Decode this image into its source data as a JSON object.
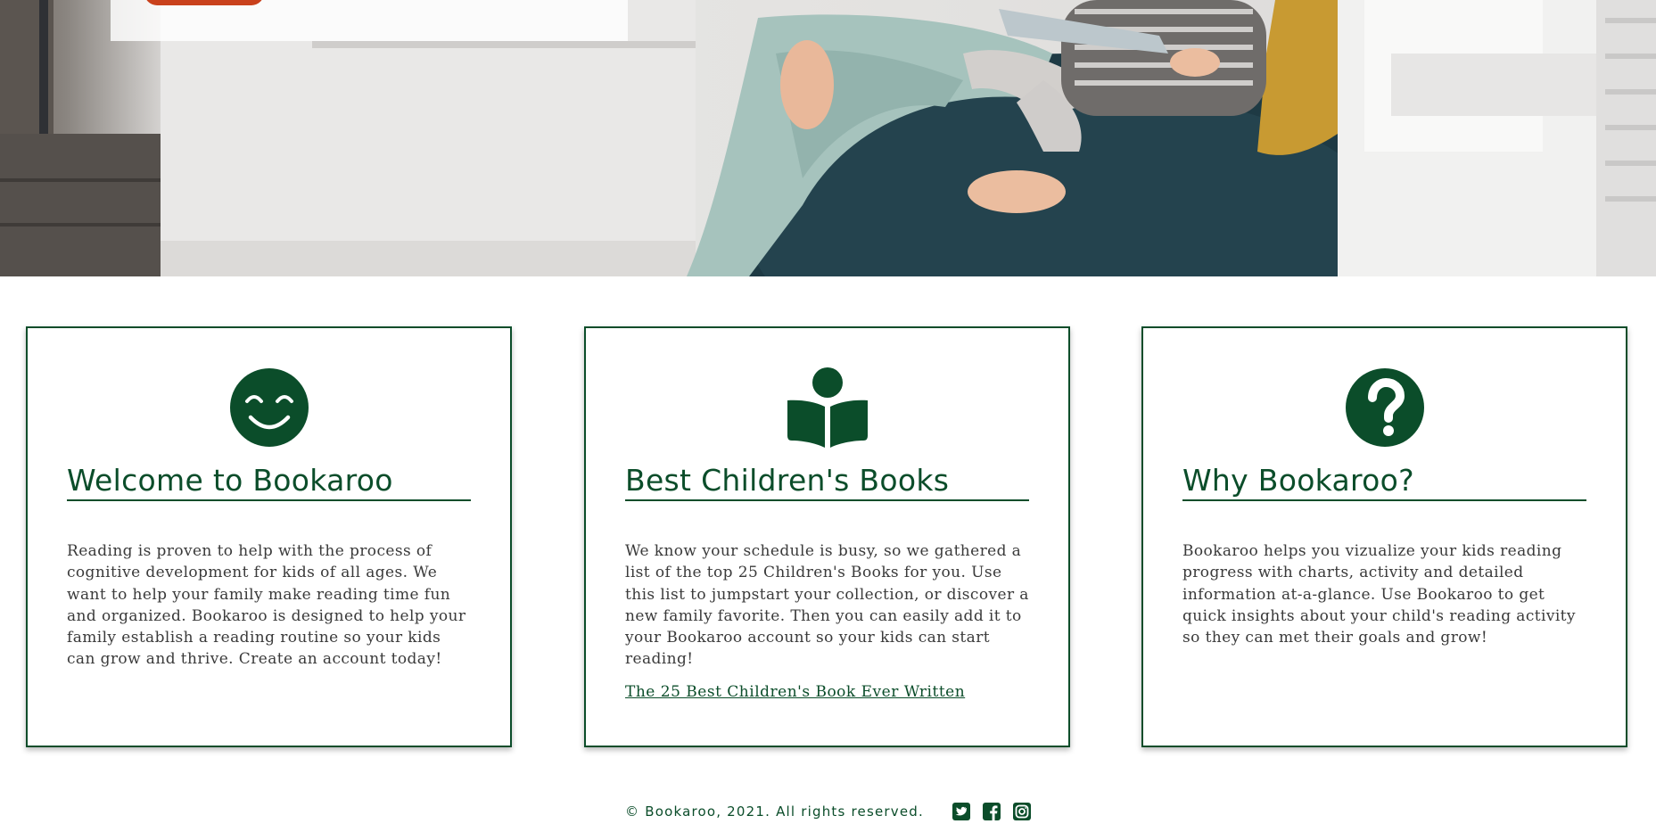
{
  "hero": {
    "image_description_name": "child-reading-hero-photo",
    "cta_label": ""
  },
  "cards": [
    {
      "icon": "smile-icon",
      "title": "Welcome to Bookaroo",
      "body": "Reading is proven to help with the process of cognitive development for kids of all ages. We want to help your family make reading time fun and organized. Bookaroo is designed to help your family establish a reading routine so your kids can grow and thrive. Create an account today!"
    },
    {
      "icon": "book-reader-icon",
      "title": "Best Children's Books",
      "body": "We know your schedule is busy, so we gathered a list of the top 25 Children's Books for you. Use this list to jumpstart your collection, or discover a new family favorite. Then you can easily add it to your Bookaroo account so your kids can start reading!",
      "link": "The 25 Best Children's Book Ever Written"
    },
    {
      "icon": "question-circle-icon",
      "title": "Why Bookaroo?",
      "body": "Bookaroo helps you vizualize your kids reading progress with charts, activity and detailed information at-a-glance. Use Bookaroo to get quick insights about your child's reading activity so they can met their goals and grow!"
    }
  ],
  "footer": {
    "copyright": "© Bookaroo, 2021. All rights reserved.",
    "social": [
      "twitter-icon",
      "facebook-icon",
      "instagram-icon"
    ]
  },
  "colors": {
    "brand_green": "#0b4d2a",
    "accent_orange": "#c9411c",
    "text": "#3a3a3a"
  }
}
